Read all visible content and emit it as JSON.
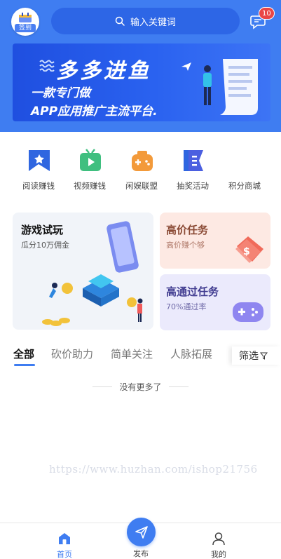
{
  "header": {
    "signin_label": "签到",
    "search_placeholder": "输入关键词",
    "message_badge": "10"
  },
  "banner": {
    "headline": "多多进鱼",
    "line1": "一款专门做",
    "line2": "APP应用推广主流平台."
  },
  "categories": [
    {
      "label": "阅读赚钱",
      "icon": "star-flag-icon",
      "color": "#2f66e0"
    },
    {
      "label": "视频赚钱",
      "icon": "video-tv-icon",
      "color": "#3fbf7f"
    },
    {
      "label": "闲娱联盟",
      "icon": "gamepad-icon",
      "color": "#f39a3a"
    },
    {
      "label": "抽奖活动",
      "icon": "flag-icon",
      "color": "#4b5fe0"
    },
    {
      "label": "积分商城",
      "icon": "",
      "color": ""
    }
  ],
  "cards": {
    "game": {
      "title": "游戏试玩",
      "subtitle": "瓜分10万佣金"
    },
    "high": {
      "title": "高价任务",
      "subtitle": "高价赚个够"
    },
    "pass": {
      "title": "高通过任务",
      "subtitle": "70%通过率"
    }
  },
  "tabs": [
    "全部",
    "砍价助力",
    "简单关注",
    "人脉拓展"
  ],
  "filter_label": "筛选",
  "empty_text": "没有更多了",
  "watermark": "https://www.huzhan.com/ishop21756",
  "bottom_nav": {
    "home": "首页",
    "publish": "发布",
    "mine": "我的"
  },
  "colors": {
    "primary": "#3f7df1",
    "badge": "#e94646"
  }
}
